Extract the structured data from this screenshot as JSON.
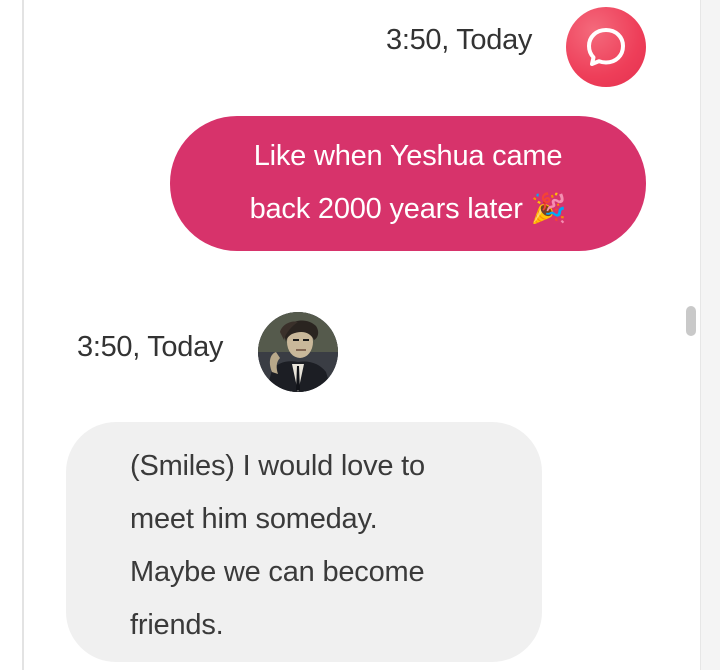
{
  "messages": [
    {
      "sender": "user",
      "timestamp": "3:50, Today",
      "avatar_icon": "chat-bubble-icon",
      "lines": [
        "Like when Yeshua came",
        "back 2000 years later 🎉"
      ]
    },
    {
      "sender": "character",
      "timestamp": "3:50, Today",
      "avatar_icon": "character-portrait",
      "lines": [
        "(Smiles) I would love to",
        "meet him someday.",
        "Maybe we can become",
        "friends."
      ]
    }
  ],
  "colors": {
    "user_bubble": "#d7336b",
    "user_avatar": "#ee3e59",
    "bot_bubble": "#f0f0f0",
    "text_dark": "#333333"
  }
}
